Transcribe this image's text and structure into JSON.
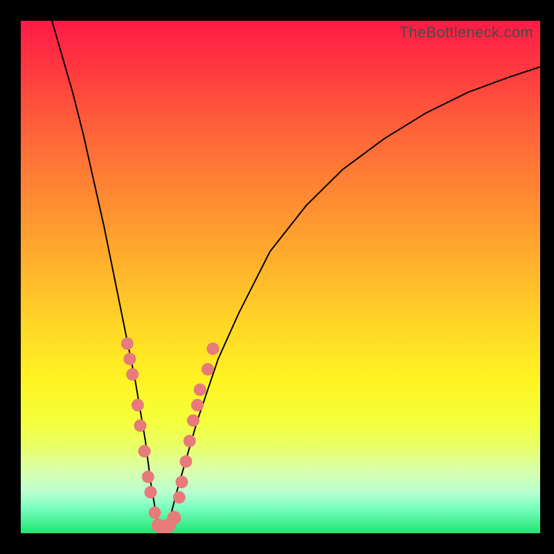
{
  "watermark": "TheBottleneck.com",
  "colors": {
    "dot": "#e77a7a",
    "curve": "#000000"
  },
  "chart_data": {
    "type": "line",
    "title": "",
    "xlabel": "",
    "ylabel": "",
    "xlim": [
      0,
      100
    ],
    "ylim": [
      0,
      100
    ],
    "description": "V-shaped bottleneck curve over rainbow gradient. Horizontal axis is relative component score (arbitrary 0-100). Vertical axis is bottleneck severity percent (0 = green/good at bottom, 100 = red/bad at top). Minimum near x≈27.",
    "series": [
      {
        "name": "bottleneck-curve",
        "x": [
          6,
          8,
          10,
          12,
          14,
          16,
          18,
          20,
          22,
          24,
          25,
          26,
          27,
          28,
          29,
          30,
          32,
          34,
          38,
          42,
          48,
          55,
          62,
          70,
          78,
          86,
          94,
          100
        ],
        "values": [
          100,
          93,
          86,
          78,
          69,
          60,
          50,
          40,
          30,
          18,
          10,
          4,
          0,
          1,
          4,
          8,
          15,
          22,
          34,
          43,
          55,
          64,
          71,
          77,
          82,
          86,
          89,
          91
        ]
      }
    ],
    "points": [
      {
        "series": "scatter-left-branch",
        "x": 20.5,
        "y": 37
      },
      {
        "series": "scatter-left-branch",
        "x": 21.0,
        "y": 34
      },
      {
        "series": "scatter-left-branch",
        "x": 21.5,
        "y": 31
      },
      {
        "series": "scatter-left-branch",
        "x": 22.5,
        "y": 25
      },
      {
        "series": "scatter-left-branch",
        "x": 23.0,
        "y": 21
      },
      {
        "series": "scatter-left-branch",
        "x": 23.8,
        "y": 16
      },
      {
        "series": "scatter-left-branch",
        "x": 24.5,
        "y": 11
      },
      {
        "series": "scatter-left-branch",
        "x": 25.0,
        "y": 8
      },
      {
        "series": "scatter-left-branch",
        "x": 25.8,
        "y": 4
      },
      {
        "series": "scatter-bottom",
        "x": 26.5,
        "y": 1.5
      },
      {
        "series": "scatter-bottom",
        "x": 27.5,
        "y": 0.5
      },
      {
        "series": "scatter-bottom",
        "x": 28.5,
        "y": 1.5
      },
      {
        "series": "scatter-bottom",
        "x": 29.5,
        "y": 3
      },
      {
        "series": "scatter-right-branch",
        "x": 30.5,
        "y": 7
      },
      {
        "series": "scatter-right-branch",
        "x": 31.0,
        "y": 10
      },
      {
        "series": "scatter-right-branch",
        "x": 31.8,
        "y": 14
      },
      {
        "series": "scatter-right-branch",
        "x": 32.5,
        "y": 18
      },
      {
        "series": "scatter-right-branch",
        "x": 33.2,
        "y": 22
      },
      {
        "series": "scatter-right-branch",
        "x": 34.0,
        "y": 25
      },
      {
        "series": "scatter-right-branch",
        "x": 34.5,
        "y": 28
      },
      {
        "series": "scatter-right-branch",
        "x": 36.0,
        "y": 32
      },
      {
        "series": "scatter-right-branch",
        "x": 37.0,
        "y": 36
      }
    ]
  }
}
